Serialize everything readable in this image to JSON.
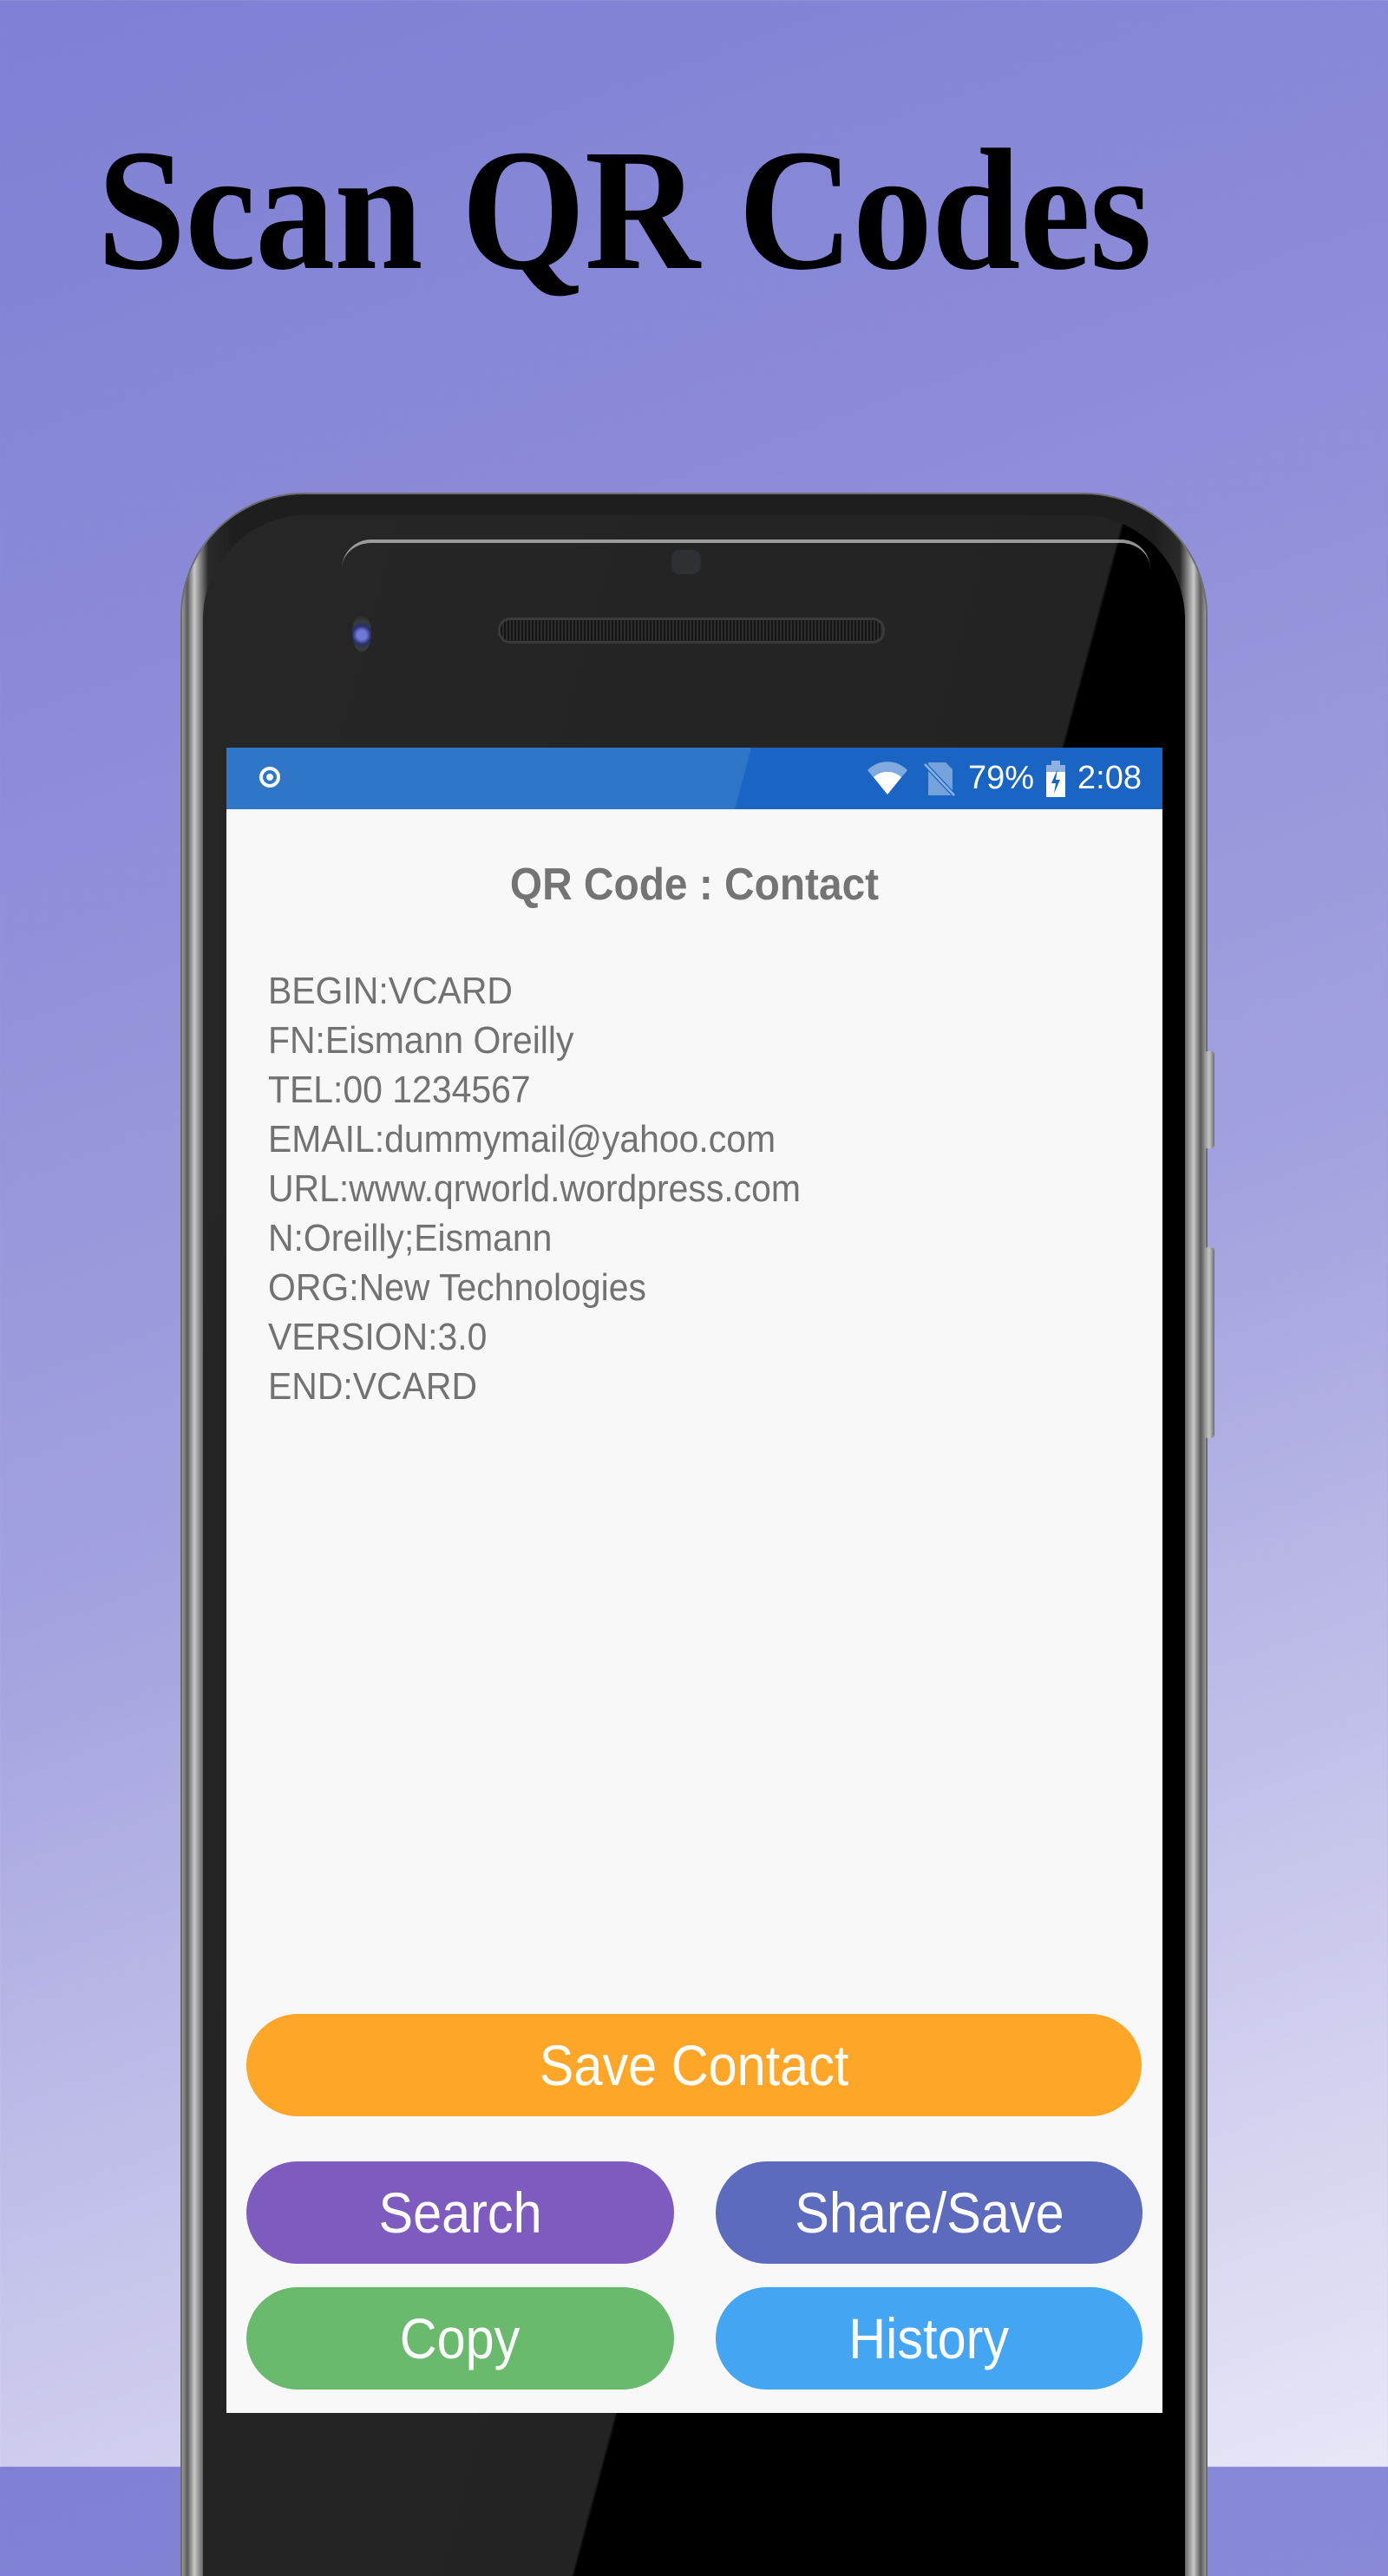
{
  "promo": {
    "headline": "Scan QR Codes"
  },
  "status_bar": {
    "left_icon": "record-icon",
    "icons": [
      "wifi-icon",
      "no-sim-icon",
      "battery-charging-icon"
    ],
    "battery_percent": "79%",
    "time": "2:08"
  },
  "screen": {
    "title": "QR Code : Contact",
    "vcard_lines": [
      "BEGIN:VCARD",
      "FN:Eismann Oreilly",
      "TEL:00 1234567",
      "EMAIL:dummymail@yahoo.com",
      "URL:www.qrworld.wordpress.com",
      "N:Oreilly;Eismann",
      "ORG:New Technologies",
      "VERSION:3.0",
      "END:VCARD"
    ]
  },
  "buttons": {
    "save_contact": {
      "label": "Save Contact",
      "color": "#fda628"
    },
    "search": {
      "label": "Search",
      "color": "#7e5bbf"
    },
    "share_save": {
      "label": "Share/Save",
      "color": "#5d6bbf"
    },
    "copy": {
      "label": "Copy",
      "color": "#69ba6c"
    },
    "history": {
      "label": "History",
      "color": "#44a5f2"
    }
  },
  "colors": {
    "status_bar": "#1a65c4",
    "screen_background": "#f8f8f8",
    "text": "#727272"
  }
}
